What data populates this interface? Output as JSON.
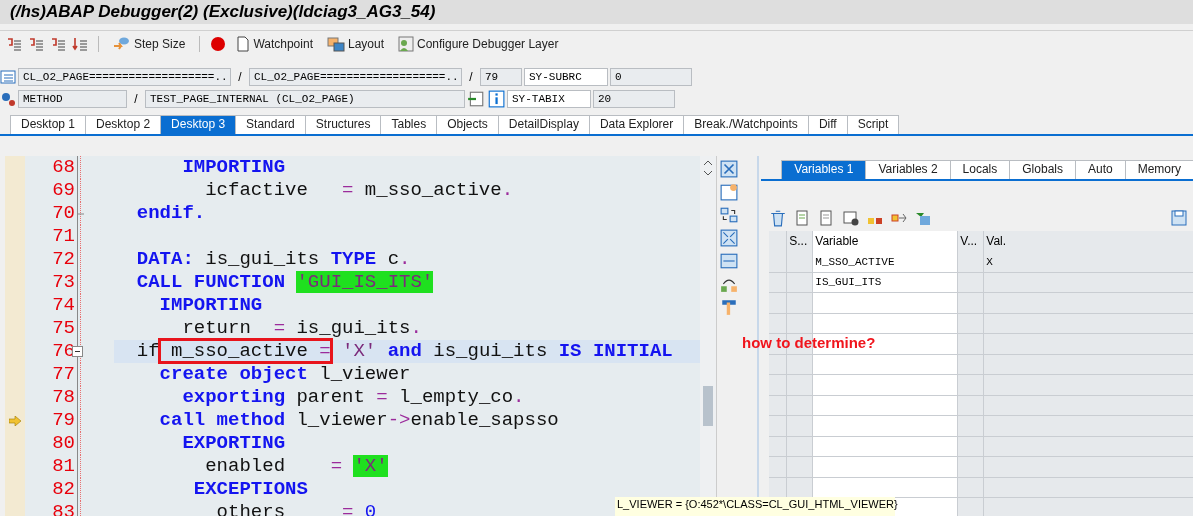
{
  "window": {
    "title": "(/hs)ABAP Debugger(2)  (Exclusive)(ldciag3_AG3_54)"
  },
  "toolbar": {
    "buttons": [
      {
        "label": "Step Size",
        "kind": "step"
      },
      {
        "label": "Watchpoint",
        "kind": "watch"
      },
      {
        "label": "Layout",
        "kind": "layout"
      },
      {
        "label": "Configure Debugger Layer",
        "kind": "config"
      }
    ]
  },
  "program_info": {
    "row_1": {
      "program": "CL_O2_PAGE===================...",
      "separator_1": "/",
      "include": "CL_O2_PAGE===================...",
      "separator_2": "/",
      "line": "79",
      "sysvar": "SY-SUBRC",
      "sysvalue": "0"
    },
    "row_2": {
      "event_type": "METHOD",
      "separator": "/",
      "event": "TEST_PAGE_INTERNAL (CL_O2_PAGE)",
      "sysvar": "SY-TABIX",
      "sysvalue": "20"
    }
  },
  "desktop_tabs": [
    {
      "label": "Desktop 1",
      "selected": false
    },
    {
      "label": "Desktop 2",
      "selected": false
    },
    {
      "label": "Desktop 3",
      "selected": true
    },
    {
      "label": "Standard",
      "selected": false
    },
    {
      "label": "Structures",
      "selected": false
    },
    {
      "label": "Tables",
      "selected": false
    },
    {
      "label": "Objects",
      "selected": false
    },
    {
      "label": "DetailDisplay",
      "selected": false
    },
    {
      "label": "Data Explorer",
      "selected": false
    },
    {
      "label": "Break./Watchpoints",
      "selected": false
    },
    {
      "label": "Diff",
      "selected": false
    },
    {
      "label": "Script",
      "selected": false
    }
  ],
  "code": [
    {
      "num": "68",
      "tokens": [
        {
          "text": "      IMPORTING",
          "kind": "keyword"
        }
      ]
    },
    {
      "num": "69",
      "tokens": [
        {
          "text": "        icfactive   ",
          "kind": "name"
        },
        {
          "text": "=",
          "kind": "operator"
        },
        {
          "text": " m_sso_active",
          "kind": "name"
        },
        {
          "text": ".",
          "kind": "operator"
        }
      ]
    },
    {
      "num": "70",
      "block_end": true,
      "tokens": [
        {
          "text": "  endif.",
          "kind": "keyword"
        }
      ]
    },
    {
      "num": "71"
    },
    {
      "num": "72",
      "tokens": [
        {
          "text": "  DATA:",
          "kind": "keyword"
        },
        {
          "text": " is_gui_its ",
          "kind": "name"
        },
        {
          "text": "TYPE",
          "kind": "keyword"
        },
        {
          "text": " c",
          "kind": "name"
        },
        {
          "text": ".",
          "kind": "operator"
        }
      ]
    },
    {
      "num": "73",
      "tokens": [
        {
          "text": "  CALL FUNCTION ",
          "kind": "keyword"
        },
        {
          "text": "'GUI_IS_ITS'",
          "kind": "hit"
        }
      ]
    },
    {
      "num": "74",
      "tokens": [
        {
          "text": "    IMPORTING",
          "kind": "keyword"
        }
      ]
    },
    {
      "num": "75",
      "tokens": [
        {
          "text": "      return  ",
          "kind": "name"
        },
        {
          "text": "=",
          "kind": "operator"
        },
        {
          "text": " is_gui_its",
          "kind": "name"
        },
        {
          "text": ".",
          "kind": "operator"
        }
      ]
    },
    {
      "num": "76",
      "cursor_line": true,
      "collapsible": true,
      "tokens": [
        {
          "text": "  if",
          "kind": "name"
        },
        {
          "text": " m_sso_active ",
          "kind": "name",
          "annotated": true
        },
        {
          "text": "=",
          "kind": "operator",
          "annotated": true
        },
        {
          "text": " 'X'",
          "kind": "literal"
        },
        {
          "text": " and ",
          "kind": "keyword"
        },
        {
          "text": "is_gui_its ",
          "kind": "name"
        },
        {
          "text": "IS INITIAL",
          "kind": "keyword"
        }
      ]
    },
    {
      "num": "77",
      "tokens": [
        {
          "text": "    create object ",
          "kind": "keyword"
        },
        {
          "text": "l_viewer",
          "kind": "name"
        }
      ]
    },
    {
      "num": "78",
      "tokens": [
        {
          "text": "      exporting ",
          "kind": "keyword"
        },
        {
          "text": "parent ",
          "kind": "name"
        },
        {
          "text": "=",
          "kind": "operator"
        },
        {
          "text": " l_empty_co",
          "kind": "name"
        },
        {
          "text": ".",
          "kind": "operator"
        }
      ]
    },
    {
      "num": "79",
      "current": true,
      "tokens": [
        {
          "text": "    call method ",
          "kind": "keyword"
        },
        {
          "text": "l_viewer",
          "kind": "name"
        },
        {
          "text": "->",
          "kind": "operator"
        },
        {
          "text": "enable_sapsso",
          "kind": "name"
        }
      ]
    },
    {
      "num": "80",
      "tokens": [
        {
          "text": "      EXPORTING",
          "kind": "keyword"
        }
      ]
    },
    {
      "num": "81",
      "tokens": [
        {
          "text": "        enabled    ",
          "kind": "name"
        },
        {
          "text": "= ",
          "kind": "operator"
        },
        {
          "text": "'X'",
          "kind": "hit"
        }
      ]
    },
    {
      "num": "82",
      "tokens": [
        {
          "text": "       EXCEPTIONS",
          "kind": "keyword"
        }
      ]
    },
    {
      "num": "83",
      "tokens": [
        {
          "text": "         others     ",
          "kind": "name"
        },
        {
          "text": "=",
          "kind": "operator"
        },
        {
          "text": " 0",
          "kind": "number"
        }
      ]
    }
  ],
  "tooltip": "L_VIEWER = {O:452*\\CLASS=CL_GUI_HTML_VIEWER}",
  "variable_tabs": [
    {
      "label": "Variables 1",
      "selected": true
    },
    {
      "label": "Variables 2",
      "selected": false
    },
    {
      "label": "Locals",
      "selected": false
    },
    {
      "label": "Globals",
      "selected": false
    },
    {
      "label": "Auto",
      "selected": false
    },
    {
      "label": "Memory",
      "selected": false
    }
  ],
  "variables": {
    "columns": [
      "S...",
      "Variable",
      "V...",
      "Val."
    ],
    "rows": [
      {
        "variable": "M_SSO_ACTIVE",
        "value": "X"
      },
      {
        "variable": "IS_GUI_ITS"
      }
    ]
  },
  "annotation": {
    "text": "how to determine?"
  }
}
